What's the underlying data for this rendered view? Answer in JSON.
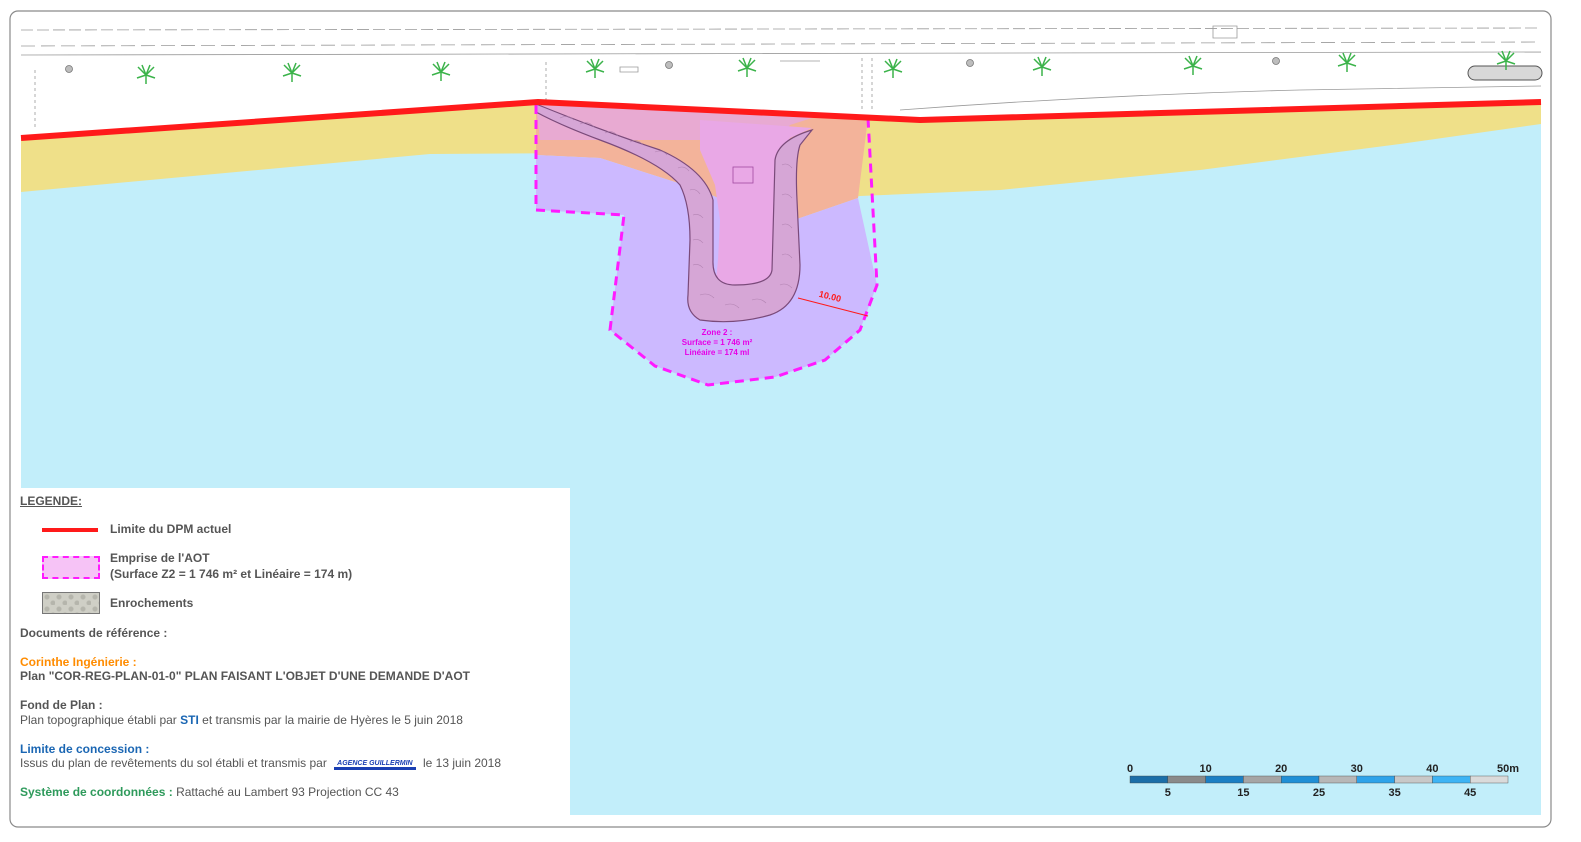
{
  "colors": {
    "sea": "#c2eefa",
    "beach": "#efe089",
    "dpm_line": "#ff1a1a",
    "aot_fill": "#ccb9ff",
    "aot_border": "#ff1aff",
    "aot_land": "#f3b39a",
    "jetty_fill": "#e5a8e0",
    "rock_fill": "#d6a6d6",
    "pink_text": "#e600e6",
    "orange_text": "#ff8c00",
    "blue_text": "#1a66b3",
    "green_text": "#2e9a5b"
  },
  "map": {
    "dimension_label": "10.00",
    "zone_title": "Zone 2 :",
    "zone_surface": "Surface = 1 746 m²",
    "zone_lineaire": "Linéaire = 174 ml"
  },
  "legend": {
    "title": "LEGENDE:",
    "items": [
      {
        "label": "Limite du DPM actuel",
        "icon": "red-line"
      },
      {
        "label": "Emprise de l'AOT",
        "sublabel": "(Surface Z2 = 1 746 m² et Linéaire = 174 m)",
        "icon": "pink-dashed-box"
      },
      {
        "label": "Enrochements",
        "icon": "rock-pattern"
      }
    ],
    "docs_title": "Documents de référence :",
    "corinthe_title": "Corinthe Ingénierie :",
    "corinthe_prefix": "Plan",
    "corinthe_text": "\"COR-REG-PLAN-01-0\" PLAN FAISANT L'OBJET D'UNE DEMANDE D'AOT",
    "fond_title": "Fond de Plan :",
    "fond_text_1": "Plan topographique établi par",
    "fond_sti": "STI",
    "fond_text_2": "et transmis par la mairie de Hyères le 5 juin 2018",
    "limite_title": "Limite de concession :",
    "limite_text_1": "Issus du plan de revêtements du sol établi et transmis par",
    "limite_logo": "AGENCE GUILLERMIN",
    "limite_text_2": "le 13 juin 2018",
    "systeme_title": "Système de coordonnées :",
    "systeme_text": "Rattaché au Lambert 93 Projection CC 43"
  },
  "scale_bar": {
    "top_labels": [
      "0",
      "10",
      "20",
      "30",
      "40",
      "50m"
    ],
    "bottom_labels": [
      "5",
      "15",
      "25",
      "35",
      "45"
    ],
    "segment_colors": [
      "#1b6ea8",
      "#8a8a8a",
      "#1b7fc4",
      "#a5a5a5",
      "#1f8fd6",
      "#b7b7b7",
      "#2ea3ea",
      "#c8c8c8",
      "#3db4f5",
      "#dadada"
    ]
  }
}
